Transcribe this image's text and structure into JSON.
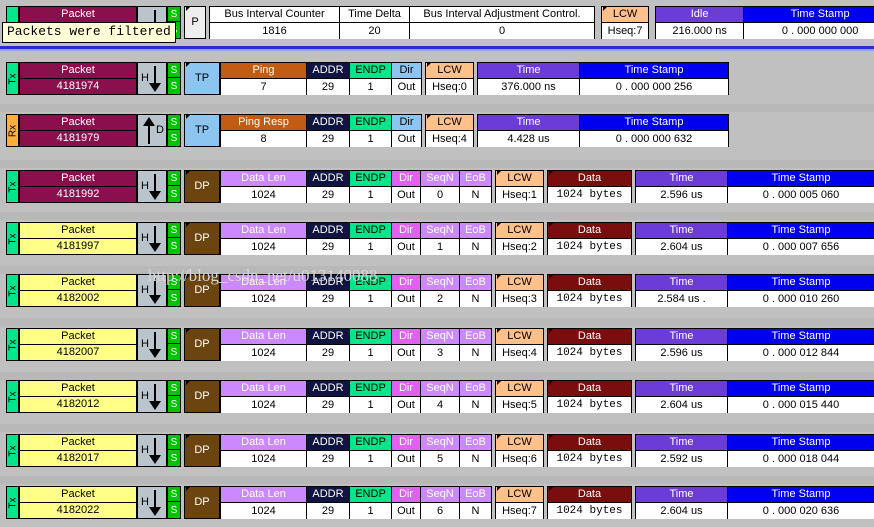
{
  "tooltip": {
    "text": "Packets were filtered"
  },
  "watermark": {
    "text": "http://blog_csdn_net/u013140088"
  },
  "header_row": {
    "packet_label": "Packet",
    "tag": "P",
    "fields": [
      {
        "label": "Bus Interval Counter",
        "value": "1816"
      },
      {
        "label": "Time Delta",
        "value": "20"
      },
      {
        "label": "Bus Interval Adjustment Control.",
        "value": "0"
      }
    ],
    "lcw": {
      "label": "LCW",
      "value": "Hseq:7"
    },
    "idle": {
      "label": "Idle",
      "value": "216.000 ns"
    },
    "timestamp": {
      "label": "Time Stamp",
      "value": "0 . 000 000 000"
    }
  },
  "col_labels": {
    "packet": "Packet",
    "addr": "ADDR",
    "endp": "ENDP",
    "dir": "Dir",
    "seqn": "SeqN",
    "eob": "EoB",
    "lcw": "LCW",
    "data": "Data",
    "data_len": "Data Len",
    "time": "Time",
    "time_stamp": "Time Stamp",
    "flag_s": "S",
    "flag_h": "H",
    "flag_d": "D",
    "tx": "Tx",
    "rx": "Rx",
    "tag_tp": "TP",
    "tag_dp": "DP"
  },
  "rows": [
    {
      "kind": "token",
      "dir_io": "Tx",
      "packet_id": "4181974",
      "packet_color": "maroon",
      "arrow": "down",
      "arrow_label": "H",
      "flags": [
        "S",
        "S"
      ],
      "tag": "TP",
      "pid_label": "Ping",
      "pid_value": "7",
      "addr": "29",
      "endp": "1",
      "dir": "Out",
      "lcw": "Hseq:0",
      "time": "376.000 ns",
      "time_stamp": "0 . 000 000 256"
    },
    {
      "kind": "token",
      "dir_io": "Rx",
      "packet_id": "4181979",
      "packet_color": "maroon",
      "arrow": "up",
      "arrow_label": "D",
      "flags": [
        "S",
        "S"
      ],
      "tag": "TP",
      "pid_label": "Ping Resp",
      "pid_value": "8",
      "addr": "29",
      "endp": "1",
      "dir": "Out",
      "lcw": "Hseq:4",
      "time": "4.428 us",
      "time_stamp": "0 . 000 000 632"
    },
    {
      "kind": "data",
      "dir_io": "Tx",
      "packet_id": "4181992",
      "packet_color": "maroon",
      "arrow": "down",
      "arrow_label": "H",
      "flags": [
        "S",
        "S"
      ],
      "tag": "DP",
      "data_len": "1024",
      "addr": "29",
      "endp": "1",
      "dir": "Out",
      "seqn": "0",
      "eob": "N",
      "lcw": "Hseq:1",
      "data": "1024 bytes",
      "time": "2.596 us",
      "time_stamp": "0 . 000 005 060"
    },
    {
      "kind": "data",
      "dir_io": "Tx",
      "packet_id": "4181997",
      "packet_color": "yellow",
      "arrow": "down",
      "arrow_label": "H",
      "flags": [
        "S",
        "S"
      ],
      "tag": "DP",
      "data_len": "1024",
      "addr": "29",
      "endp": "1",
      "dir": "Out",
      "seqn": "1",
      "eob": "N",
      "lcw": "Hseq:2",
      "data": "1024 bytes",
      "time": "2.604 us",
      "time_stamp": "0 . 000 007 656"
    },
    {
      "kind": "data",
      "dir_io": "Tx",
      "packet_id": "4182002",
      "packet_color": "yellow",
      "arrow": "down",
      "arrow_label": "H",
      "flags": [
        "S",
        "S"
      ],
      "tag": "DP",
      "data_len": "1024",
      "addr": "29",
      "endp": "1",
      "dir": "Out",
      "seqn": "2",
      "eob": "N",
      "lcw": "Hseq:3",
      "data": "1024 bytes",
      "time": "2.584 us .",
      "time_stamp": "0 . 000 010 260"
    },
    {
      "kind": "data",
      "dir_io": "Tx",
      "packet_id": "4182007",
      "packet_color": "yellow",
      "arrow": "down",
      "arrow_label": "H",
      "flags": [
        "S",
        "S"
      ],
      "tag": "DP",
      "data_len": "1024",
      "addr": "29",
      "endp": "1",
      "dir": "Out",
      "seqn": "3",
      "eob": "N",
      "lcw": "Hseq:4",
      "data": "1024 bytes",
      "time": "2.596 us",
      "time_stamp": "0 . 000 012 844"
    },
    {
      "kind": "data",
      "dir_io": "Tx",
      "packet_id": "4182012",
      "packet_color": "yellow",
      "arrow": "down",
      "arrow_label": "H",
      "flags": [
        "S",
        "S"
      ],
      "tag": "DP",
      "data_len": "1024",
      "addr": "29",
      "endp": "1",
      "dir": "Out",
      "seqn": "4",
      "eob": "N",
      "lcw": "Hseq:5",
      "data": "1024 bytes",
      "time": "2.604 us",
      "time_stamp": "0 . 000 015 440"
    },
    {
      "kind": "data",
      "dir_io": "Tx",
      "packet_id": "4182017",
      "packet_color": "yellow",
      "arrow": "down",
      "arrow_label": "H",
      "flags": [
        "S",
        "S"
      ],
      "tag": "DP",
      "data_len": "1024",
      "addr": "29",
      "endp": "1",
      "dir": "Out",
      "seqn": "5",
      "eob": "N",
      "lcw": "Hseq:6",
      "data": "1024 bytes",
      "time": "2.592 us",
      "time_stamp": "0 . 000 018 044"
    },
    {
      "kind": "data",
      "dir_io": "Tx",
      "packet_id": "4182022",
      "packet_color": "yellow",
      "arrow": "down",
      "arrow_label": "H",
      "flags": [
        "S",
        "S"
      ],
      "tag": "DP",
      "data_len": "1024",
      "addr": "29",
      "endp": "1",
      "dir": "Out",
      "seqn": "6",
      "eob": "N",
      "lcw": "Hseq:7",
      "data": "1024 bytes",
      "time": "2.604 us",
      "time_stamp": "0 . 000 020 636"
    }
  ],
  "colors": {
    "time_header": "#6c3cd8",
    "timestamp_header": "#0000ee",
    "lcw_header": "#ffc08a",
    "data_header": "#7a0d0d",
    "addr_header": "#101440",
    "endp_header": "#00e68a",
    "dir_header": "#e060f0",
    "datalen_header": "#cc88ff",
    "packet_header": "#8a0f4c",
    "tx_badge": "#00e68a",
    "rx_badge": "#ffae3a",
    "background": "#c0c0c0"
  }
}
